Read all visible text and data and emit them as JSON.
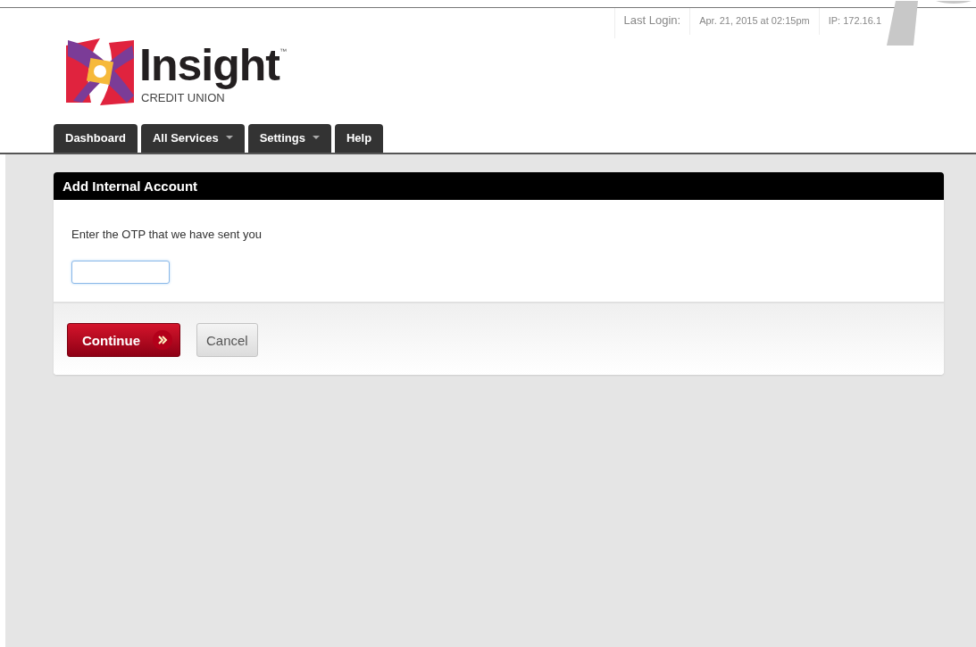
{
  "last_login": {
    "label": "Last Login:",
    "date": "Apr. 21, 2015 at 02:15pm",
    "ip": "IP: 172.16.1"
  },
  "logo": {
    "name": "Insight",
    "trademark": "™",
    "subtitle": "CREDIT UNION"
  },
  "tabs": [
    {
      "label": "Dashboard",
      "menu": false
    },
    {
      "label": "All Services",
      "menu": true
    },
    {
      "label": "Settings",
      "menu": true
    },
    {
      "label": "Help",
      "menu": false
    }
  ],
  "panel": {
    "title": "Add Internal Account",
    "prompt": "Enter the OTP that we have sent you",
    "buttons": [
      {
        "label": "Continue",
        "kind": "primary"
      },
      {
        "label": "Cancel",
        "kind": "secondary"
      }
    ]
  }
}
